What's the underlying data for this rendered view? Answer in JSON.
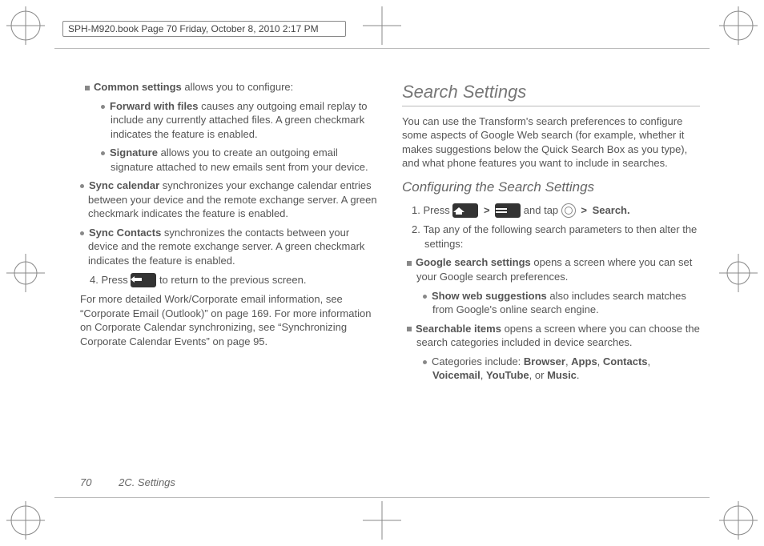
{
  "header": "SPH-M920.book  Page 70  Friday, October 8, 2010  2:17 PM",
  "left": {
    "common_intro_bold": "Common settings",
    "common_intro_rest": " allows you to configure:",
    "fwd_bold": "Forward with files",
    "fwd_rest": " causes any outgoing email replay to include any currently attached files. A green checkmark indicates the feature is enabled.",
    "sig_bold": "Signature",
    "sig_rest": " allows you to create an outgoing email signature attached to new emails sent from your device.",
    "sync_cal_bold": "Sync calendar",
    "sync_cal_rest": " synchronizes your exchange calendar entries between your device and the remote exchange server. A green checkmark indicates the feature is enabled.",
    "sync_con_bold": "Sync Contacts",
    "sync_con_rest": " synchronizes the contacts between your device and the remote exchange server. A green checkmark indicates the feature is enabled.",
    "step4_num": "4.",
    "step4_a": "Press ",
    "step4_b": " to return to the previous screen.",
    "para_more": "For more detailed Work/Corporate email information, see “Corporate Email (Outlook)” on page 169. For more information on Corporate Calendar synchronizing, see “Synchronizing Corporate Calendar Events” on page 95."
  },
  "right": {
    "h2": "Search Settings",
    "intro": "You can use the Transform's search preferences to configure some aspects of Google Web search (for example, whether it makes suggestions below the Quick Search Box as you type), and what phone features you want to include in searches.",
    "h3": "Configuring the Search Settings",
    "s1_num": "1.",
    "s1_a": "Press ",
    "s1_b": " and tap ",
    "s1_search": "Search.",
    "s2_num": "2.",
    "s2_text": "Tap any of the following search parameters to then alter the settings:",
    "gss_bold": "Google search settings",
    "gss_rest": " opens a screen where you can set your Google search preferences.",
    "sws_bold": "Show web suggestions",
    "sws_rest": " also includes search matches from Google's online search engine.",
    "si_bold": "Searchable items",
    "si_rest": " opens a screen where you can choose the search categories included in device searches.",
    "cat_lead": "Categories include: ",
    "cat1": "Browser",
    "cat2": "Apps",
    "cat3": "Contacts",
    "cat4": "Voicemail",
    "cat5": "YouTube",
    "cat_or": ", or ",
    "cat6": "Music",
    "cat_end": "."
  },
  "footer": {
    "page": "70",
    "chapter": "2C. Settings"
  }
}
